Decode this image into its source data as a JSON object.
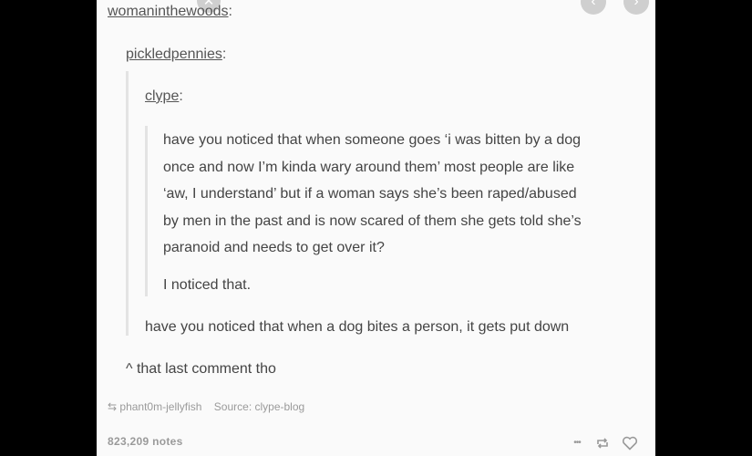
{
  "post": {
    "users": {
      "level1": "womaninthewoods",
      "level2": "pickledpennies",
      "level3": "clype"
    },
    "colon": ":",
    "clype_paragraph_lines": [
      "have you noticed that when someone goes ‘i was bitten by a dog",
      "once and now I’m kinda wary around them’ most people are like",
      "‘aw, I understand’ but if a woman says she’s been raped/abused",
      "by men in the past and is now scared of them she gets told she’s",
      "paranoid and needs to get over it?"
    ],
    "clype_reply": "I noticed that.",
    "pickled_reply": "have you noticed that when a dog bites a person, it gets put down",
    "final_comment": "^ that last comment tho",
    "reblog_source_user": "phant0m-jellyfish",
    "source_label": "Source:",
    "source_value": "clype-blog",
    "notes_count": "823,209 notes",
    "more_label": "•••"
  },
  "colors": {
    "background": "#000000",
    "card": "#fafafa",
    "text": "#444444",
    "meta": "#9a9a9a"
  },
  "icons": [
    "close-icon",
    "chevron-left-icon",
    "chevron-right-icon",
    "reblog-icon",
    "more-icon",
    "heart-icon"
  ]
}
